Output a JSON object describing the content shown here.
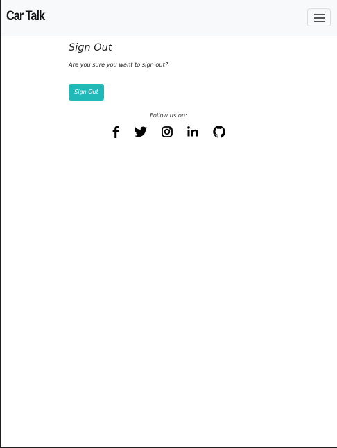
{
  "navbar": {
    "brand": "Car Talk",
    "toggler_icon": "hamburger-menu-icon"
  },
  "main": {
    "title": "Sign Out",
    "prompt": "Are you sure you want to sign out?",
    "signout_button_label": "Sign Out",
    "accent_color": "#20b9b7"
  },
  "footer": {
    "follow_text": "Follow us on:",
    "social_links": [
      {
        "icon": "facebook-icon"
      },
      {
        "icon": "twitter-icon"
      },
      {
        "icon": "instagram-icon"
      },
      {
        "icon": "linkedin-icon"
      },
      {
        "icon": "github-icon"
      }
    ]
  }
}
